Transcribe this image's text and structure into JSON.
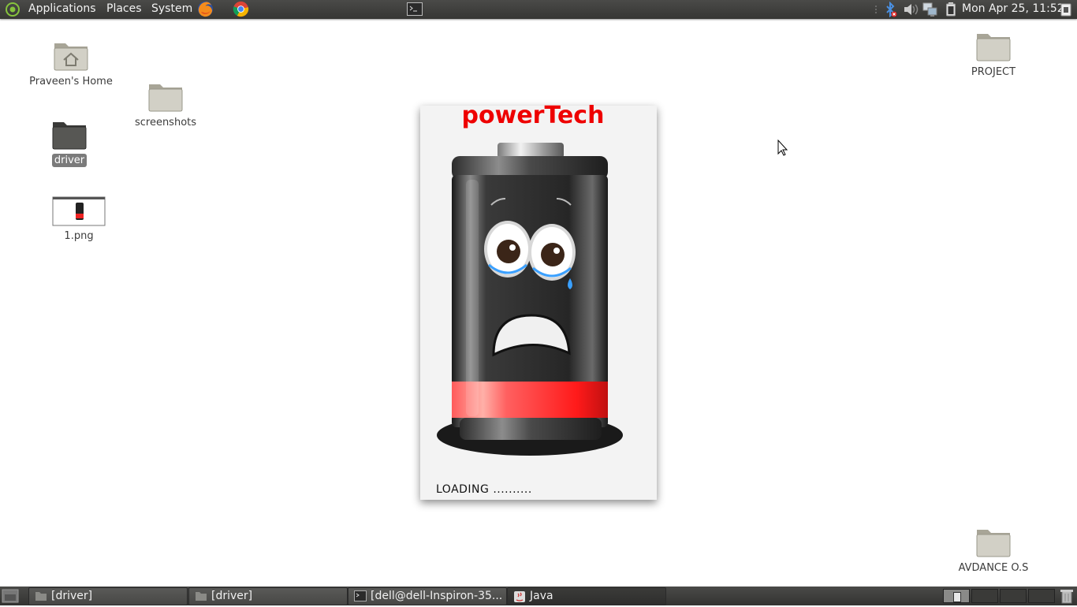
{
  "top_panel": {
    "menus": [
      "Applications",
      "Places",
      "System"
    ],
    "clock": "Mon Apr 25, 11:52",
    "launchers": [
      "firefox-icon",
      "chrome-icon",
      "terminal-icon"
    ],
    "tray_icons": [
      "bluetooth-icon",
      "volume-icon",
      "network-icon",
      "battery-icon",
      "show-desktop-icon"
    ]
  },
  "desktop": {
    "icons": [
      {
        "label": "Praveen's Home",
        "icon": "home-folder-icon"
      },
      {
        "label": "screenshots",
        "icon": "folder-icon"
      },
      {
        "label": "driver",
        "icon": "folder-icon",
        "selected": true
      },
      {
        "label": "1.png",
        "icon": "image-thumbnail-icon"
      },
      {
        "label": "PROJECT",
        "icon": "folder-icon"
      },
      {
        "label": "AVDANCE O.S",
        "icon": "folder-icon"
      }
    ]
  },
  "splash": {
    "title": "powerTech",
    "loading_text": "LOADING ..........",
    "battery_level": 0.15,
    "colors": {
      "title": "#ee0000",
      "battery_fill": "#ff2222"
    }
  },
  "taskbar": {
    "items": [
      {
        "label": "[driver]",
        "icon": "folder-icon"
      },
      {
        "label": "[driver]",
        "icon": "folder-icon"
      },
      {
        "label": "[dell@dell-Inspiron-35...",
        "icon": "terminal-icon"
      },
      {
        "label": "Java",
        "icon": "java-icon",
        "active": true
      }
    ]
  }
}
